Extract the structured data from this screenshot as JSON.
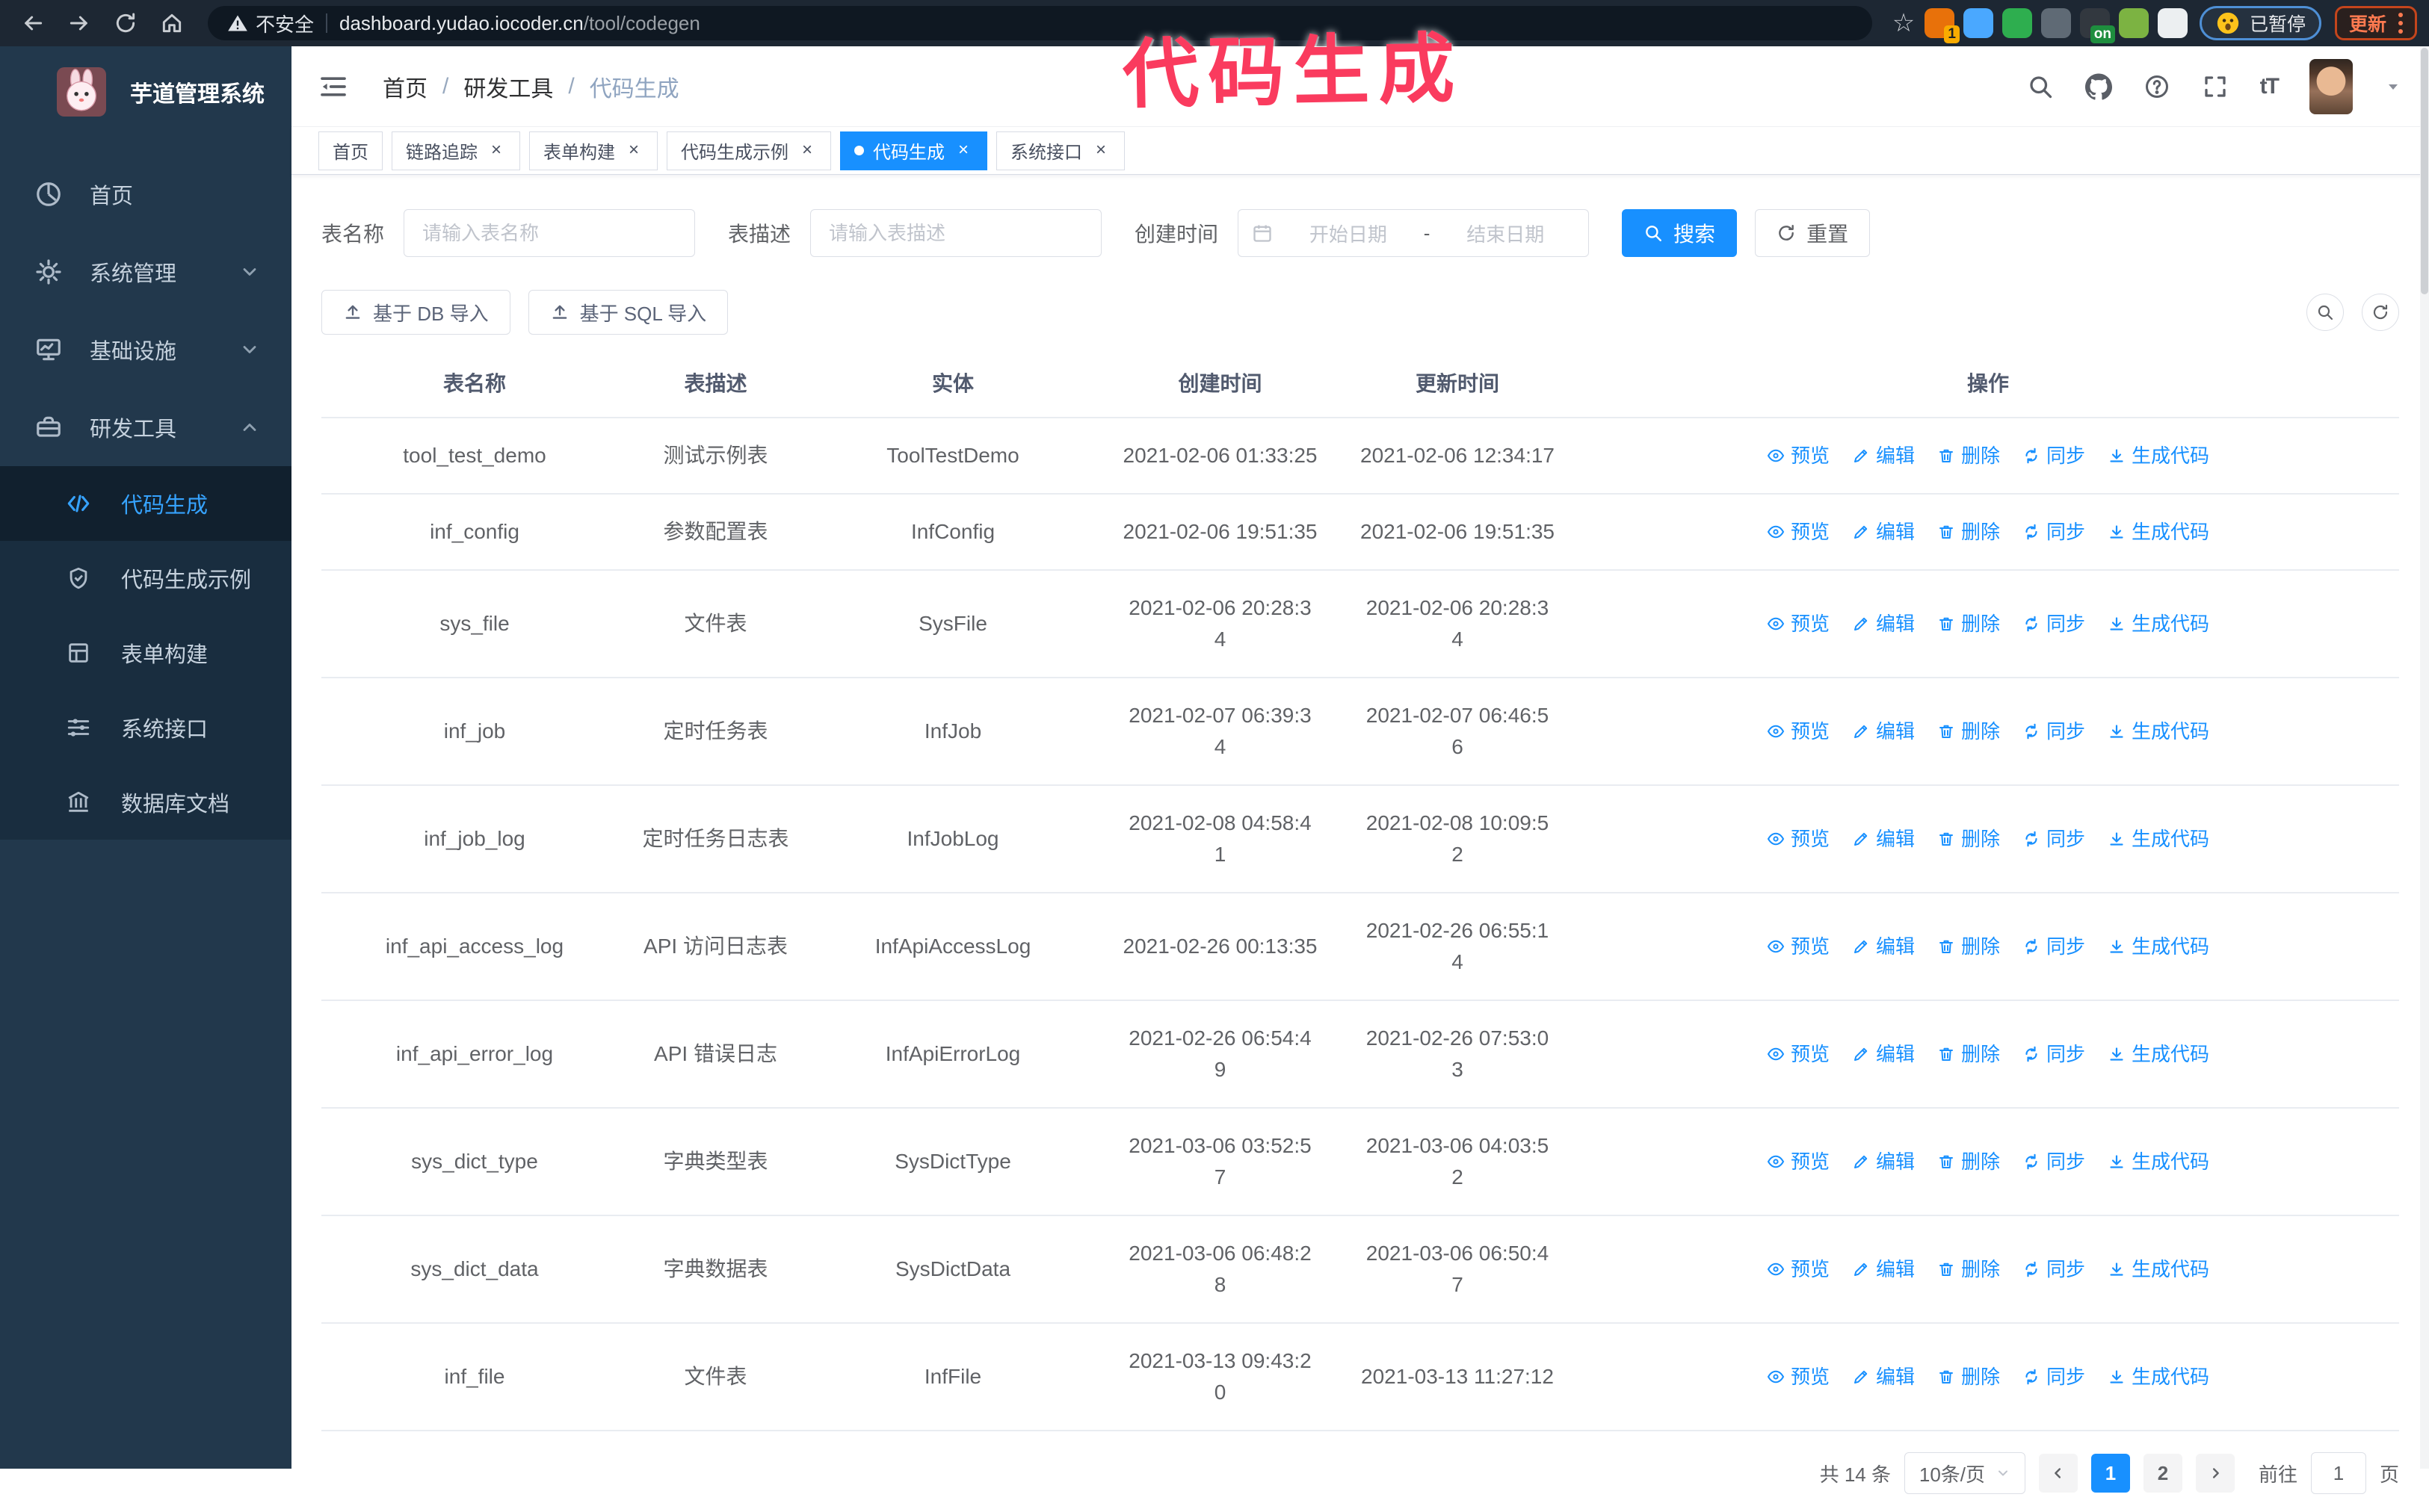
{
  "browser": {
    "security_label": "不安全",
    "url_host": "dashboard.yudao.iocoder.cn",
    "url_path": "/tool/codegen",
    "paused_badge": "已暂停",
    "update_button": "更新",
    "extensions": [
      {
        "name": "extension-orange",
        "color": "#e8710a",
        "badge": "1"
      },
      {
        "name": "extension-gem",
        "color": "#4aa8ff",
        "badge": ""
      },
      {
        "name": "extension-green-check",
        "color": "#2eae4f",
        "badge": ""
      },
      {
        "name": "extension-gray-panel",
        "color": "#5f6a75",
        "badge": ""
      },
      {
        "name": "extension-dark-switch",
        "color": "#32383f",
        "badge": "on"
      },
      {
        "name": "extension-key",
        "color": "#7cb342",
        "badge": ""
      },
      {
        "name": "extension-puzzle",
        "color": "#eceff1",
        "badge": ""
      }
    ]
  },
  "annotation": {
    "text": "代码生成",
    "color": "#fa3b5e"
  },
  "sidebar": {
    "title": "芋道管理系统",
    "items": [
      {
        "id": "home",
        "label": "首页",
        "icon": "dashboard",
        "expandable": false,
        "expanded": false
      },
      {
        "id": "system",
        "label": "系统管理",
        "icon": "gear",
        "expandable": true,
        "expanded": false
      },
      {
        "id": "infra",
        "label": "基础设施",
        "icon": "monitor",
        "expandable": true,
        "expanded": false
      },
      {
        "id": "devtools",
        "label": "研发工具",
        "icon": "toolbox",
        "expandable": true,
        "expanded": true
      }
    ],
    "submenu": [
      {
        "id": "codegen",
        "label": "代码生成",
        "icon": "code",
        "active": true
      },
      {
        "id": "codegen-demo",
        "label": "代码生成示例",
        "icon": "badge",
        "active": false
      },
      {
        "id": "form-builder",
        "label": "表单构建",
        "icon": "form",
        "active": false
      },
      {
        "id": "system-api",
        "label": "系统接口",
        "icon": "sliders",
        "active": false
      },
      {
        "id": "db-doc",
        "label": "数据库文档",
        "icon": "library",
        "active": false
      }
    ]
  },
  "header": {
    "breadcrumb": [
      "首页",
      "研发工具",
      "代码生成"
    ],
    "breadcrumb_separator": "/"
  },
  "tags": [
    {
      "label": "首页",
      "closable": false,
      "active": false
    },
    {
      "label": "链路追踪",
      "closable": true,
      "active": false
    },
    {
      "label": "表单构建",
      "closable": true,
      "active": false
    },
    {
      "label": "代码生成示例",
      "closable": true,
      "active": false
    },
    {
      "label": "代码生成",
      "closable": true,
      "active": true
    },
    {
      "label": "系统接口",
      "closable": true,
      "active": false
    }
  ],
  "search_form": {
    "table_name_label": "表名称",
    "table_name_placeholder": "请输入表名称",
    "table_desc_label": "表描述",
    "table_desc_placeholder": "请输入表描述",
    "create_time_label": "创建时间",
    "date_start_placeholder": "开始日期",
    "date_separator": "-",
    "date_end_placeholder": "结束日期",
    "search_button": "搜索",
    "reset_button": "重置"
  },
  "toolbar": {
    "import_db_button": "基于 DB 导入",
    "import_sql_button": "基于 SQL 导入"
  },
  "table": {
    "columns": [
      "表名称",
      "表描述",
      "实体",
      "创建时间",
      "更新时间",
      "操作"
    ],
    "actions": [
      {
        "label": "预览",
        "icon": "eye"
      },
      {
        "label": "编辑",
        "icon": "edit"
      },
      {
        "label": "删除",
        "icon": "trash"
      },
      {
        "label": "同步",
        "icon": "sync"
      },
      {
        "label": "生成代码",
        "icon": "download"
      }
    ],
    "rows": [
      {
        "name": "tool_test_demo",
        "desc": "测试示例表",
        "entity": "ToolTestDemo",
        "created": "2021-02-06 01:33:25",
        "updated": "2021-02-06 12:34:17"
      },
      {
        "name": "inf_config",
        "desc": "参数配置表",
        "entity": "InfConfig",
        "created": "2021-02-06 19:51:35",
        "updated": "2021-02-06 19:51:35"
      },
      {
        "name": "sys_file",
        "desc": "文件表",
        "entity": "SysFile",
        "created": "2021-02-06 20:28:3\n4",
        "updated": "2021-02-06 20:28:3\n4"
      },
      {
        "name": "inf_job",
        "desc": "定时任务表",
        "entity": "InfJob",
        "created": "2021-02-07 06:39:3\n4",
        "updated": "2021-02-07 06:46:5\n6"
      },
      {
        "name": "inf_job_log",
        "desc": "定时任务日志表",
        "entity": "InfJobLog",
        "created": "2021-02-08 04:58:4\n1",
        "updated": "2021-02-08 10:09:5\n2"
      },
      {
        "name": "inf_api_access_log",
        "desc": "API 访问日志表",
        "entity": "InfApiAccessLog",
        "created": "2021-02-26 00:13:35",
        "updated": "2021-02-26 06:55:1\n4"
      },
      {
        "name": "inf_api_error_log",
        "desc": "API 错误日志",
        "entity": "InfApiErrorLog",
        "created": "2021-02-26 06:54:4\n9",
        "updated": "2021-02-26 07:53:0\n3"
      },
      {
        "name": "sys_dict_type",
        "desc": "字典类型表",
        "entity": "SysDictType",
        "created": "2021-03-06 03:52:5\n7",
        "updated": "2021-03-06 04:03:5\n2"
      },
      {
        "name": "sys_dict_data",
        "desc": "字典数据表",
        "entity": "SysDictData",
        "created": "2021-03-06 06:48:2\n8",
        "updated": "2021-03-06 06:50:4\n7"
      },
      {
        "name": "inf_file",
        "desc": "文件表",
        "entity": "InfFile",
        "created": "2021-03-13 09:43:2\n0",
        "updated": "2021-03-13 11:27:12"
      }
    ]
  },
  "pagination": {
    "total_label": "共 14 条",
    "page_size": "10条/页",
    "pages": [
      "1",
      "2"
    ],
    "active_page": "1",
    "goto_label": "前往",
    "goto_value": "1",
    "goto_unit": "页"
  },
  "colors": {
    "primary": "#1890ff",
    "sidebar_bg": "#22384c",
    "submenu_bg": "#192d3f",
    "annotation": "#fa3b5e"
  }
}
